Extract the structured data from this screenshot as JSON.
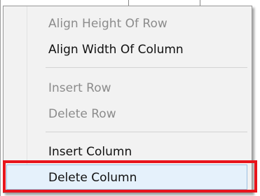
{
  "menu": {
    "items": [
      {
        "label": "Align Height Of Row",
        "enabled": false
      },
      {
        "label": "Align Width Of Column",
        "enabled": true
      },
      {
        "label": "Insert Row",
        "enabled": false
      },
      {
        "label": "Delete Row",
        "enabled": false
      },
      {
        "label": "Insert Column",
        "enabled": true
      },
      {
        "label": "Delete Column",
        "enabled": true,
        "hovered": true
      }
    ]
  },
  "colors": {
    "highlight_border": "#e8141b",
    "hover_fill": "#e5f1fb",
    "menu_background": "#f2f2f2",
    "disabled_text": "#8c8c8c"
  }
}
